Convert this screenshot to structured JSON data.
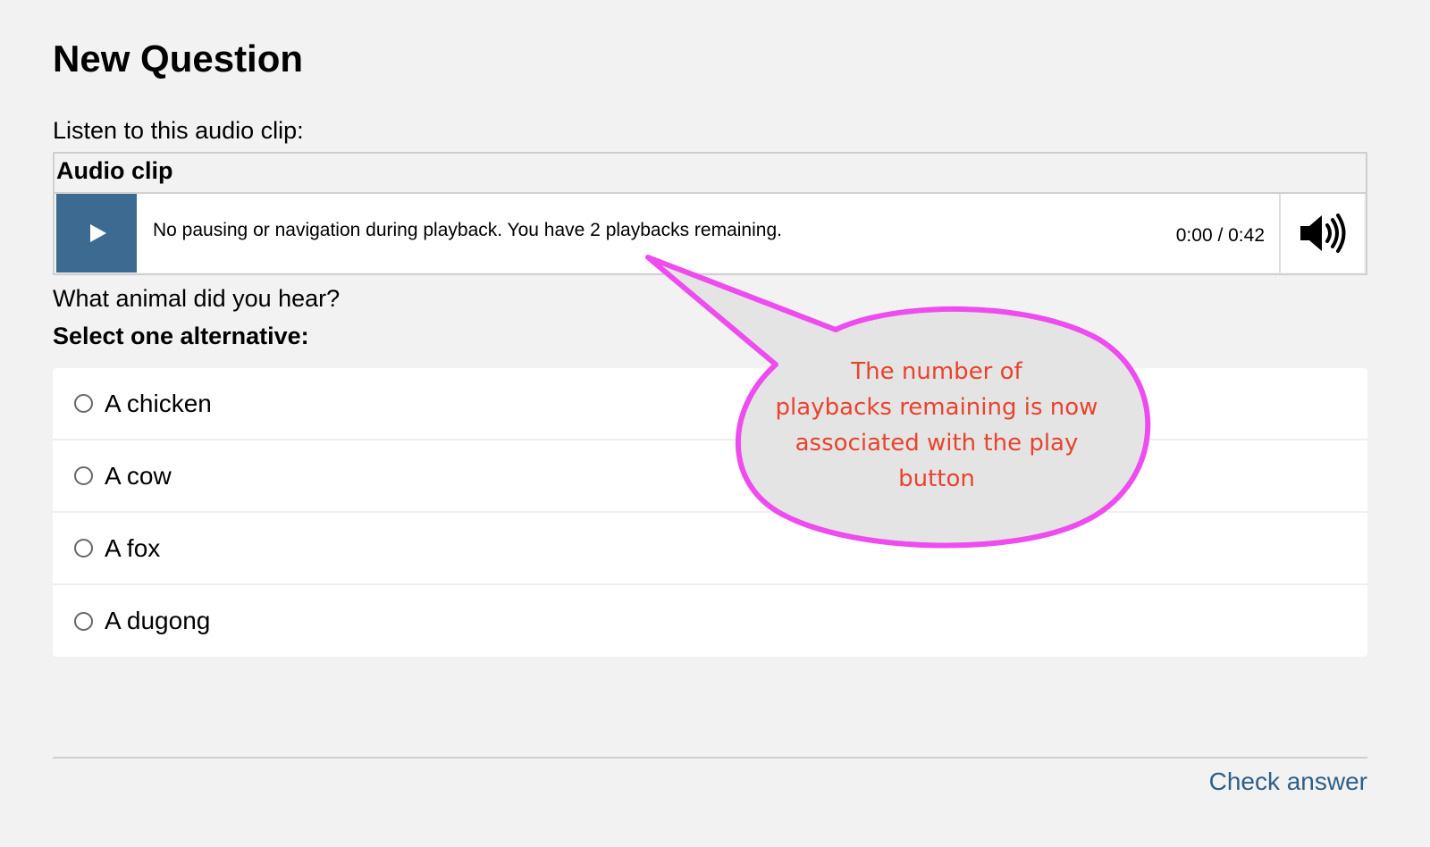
{
  "page": {
    "title": "New Question"
  },
  "prompt": {
    "intro": "Listen to this audio clip:"
  },
  "audio": {
    "header": "Audio clip",
    "status_message": "No pausing or navigation during playback.  You have 2 playbacks remaining.",
    "time": "0:00 / 0:42",
    "play_icon": "play-icon",
    "volume_icon": "speaker-volume-icon"
  },
  "question": {
    "text": "What animal did you hear?",
    "instruction": "Select one alternative:",
    "options": [
      {
        "label": "A chicken"
      },
      {
        "label": "A cow"
      },
      {
        "label": "A fox"
      },
      {
        "label": "A dugong"
      }
    ]
  },
  "footer": {
    "check_answer": "Check answer"
  },
  "callout": {
    "lines": [
      "The number of",
      "playbacks remaining is now",
      "associated with the play",
      "button"
    ],
    "text_color": "#e8432e",
    "border_color": "#ee4cef",
    "fill_color": "#e4e4e4"
  },
  "colors": {
    "play_button": "#3c6a91",
    "link": "#2e5f86",
    "background": "#f2f2f2"
  }
}
